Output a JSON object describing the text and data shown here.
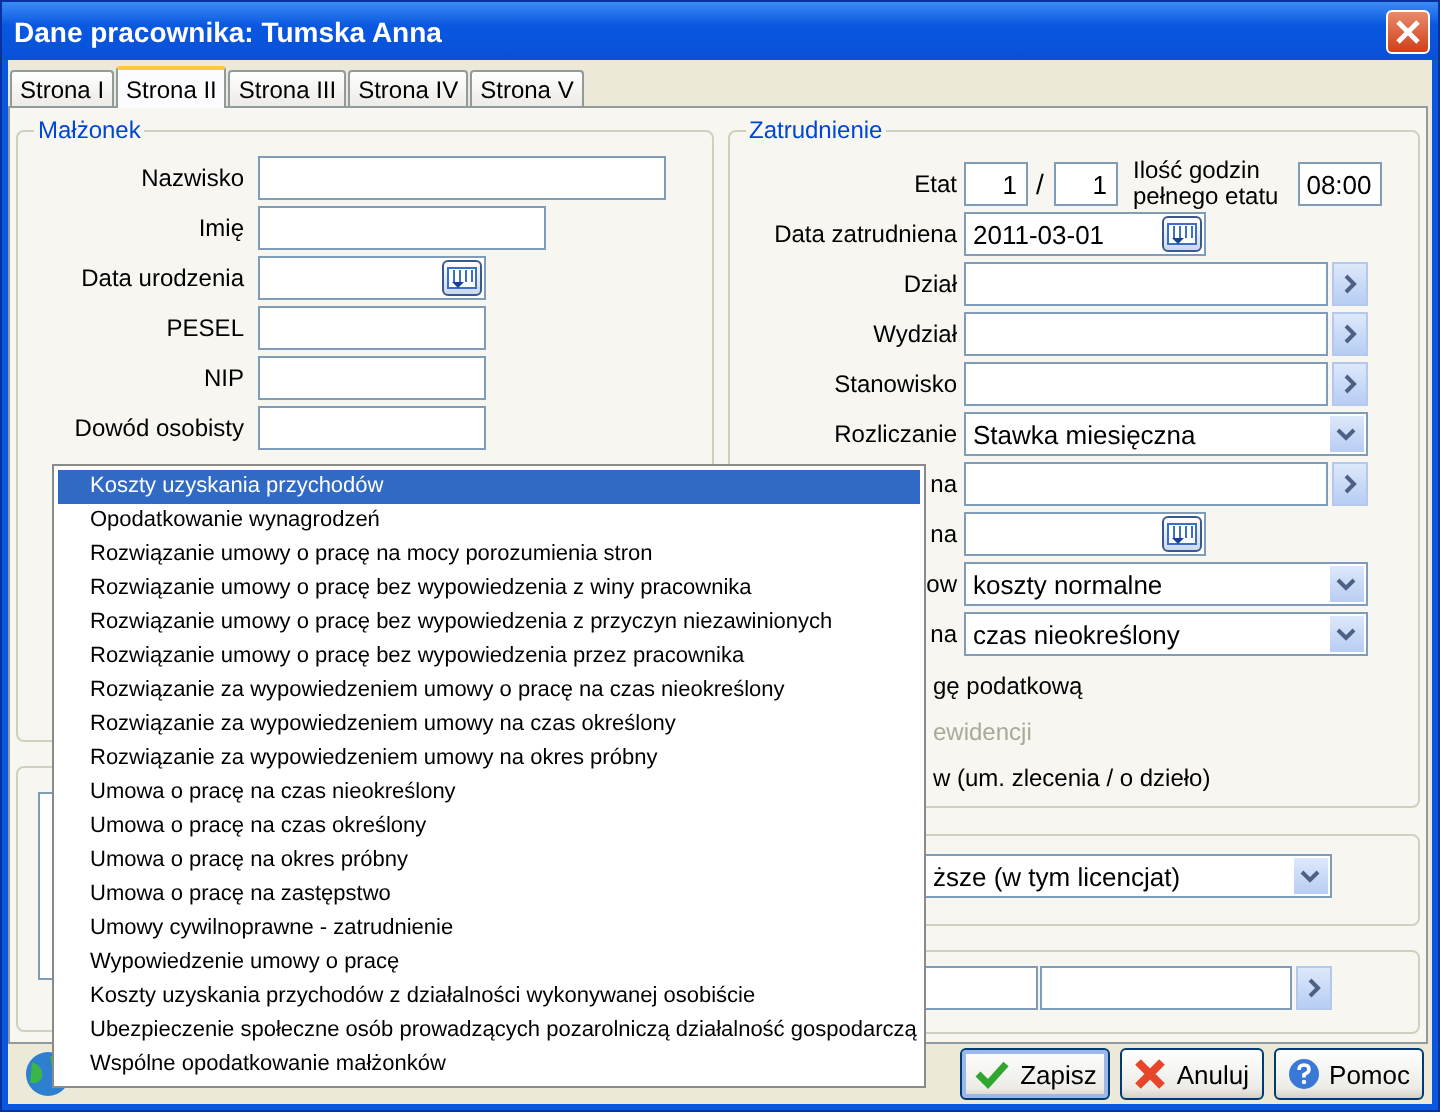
{
  "window": {
    "title": "Dane pracownika: Tumska Anna"
  },
  "tabs": [
    {
      "label": "Strona I",
      "selected": false
    },
    {
      "label": "Strona II",
      "selected": true
    },
    {
      "label": "Strona III",
      "selected": false
    },
    {
      "label": "Strona IV",
      "selected": false
    },
    {
      "label": "Strona V",
      "selected": false
    }
  ],
  "spouse": {
    "legend": "Małżonek",
    "fields": [
      {
        "kind": "text",
        "label": "Nazwisko"
      },
      {
        "kind": "text",
        "label": "Imię"
      },
      {
        "kind": "date",
        "label": "Data urodzenia"
      },
      {
        "kind": "text",
        "label": "PESEL"
      },
      {
        "kind": "text",
        "label": "NIP"
      },
      {
        "kind": "text",
        "label": "Dowód osobisty"
      }
    ]
  },
  "employment": {
    "legend": "Zatrudnienie",
    "etat": {
      "label": "Etat",
      "numerator": "1",
      "separator": "/",
      "denominator": "1",
      "hours_label": "Ilość godzin pełnego etatu",
      "hours": "08:00"
    },
    "rows": [
      {
        "kind": "date",
        "label": "Data zatrudniena",
        "value": "2011-03-01"
      },
      {
        "kind": "picker",
        "label": "Dział"
      },
      {
        "kind": "picker",
        "label": "Wydział"
      },
      {
        "kind": "picker",
        "label": "Stanowisko"
      },
      {
        "kind": "select",
        "label": "Rozliczanie",
        "value": "Stawka miesięczna"
      },
      {
        "kind": "picker",
        "label": "na"
      },
      {
        "kind": "date",
        "label": "na"
      },
      {
        "kind": "select",
        "label": "ow",
        "value": "koszty normalne"
      },
      {
        "kind": "select",
        "label": "na",
        "value": "czas nieokreślony"
      }
    ],
    "options": [
      {
        "label": "gę podatkową",
        "disabled": false
      },
      {
        "label": "ewidencji",
        "disabled": true
      },
      {
        "label": "w (um. zlecenia / o dzieło)",
        "disabled": false
      }
    ]
  },
  "education": {
    "value": "ższe (w tym licencjat)"
  },
  "menu": {
    "items": [
      {
        "label": "Koszty uzyskania przychodów",
        "selected": true
      },
      {
        "label": "Opodatkowanie wynagrodzeń",
        "selected": false
      },
      {
        "label": "Rozwiązanie umowy o pracę na mocy porozumienia stron",
        "selected": false
      },
      {
        "label": "Rozwiązanie umowy o pracę bez wypowiedzenia z winy pracownika",
        "selected": false
      },
      {
        "label": "Rozwiązanie umowy o pracę bez wypowiedzenia z przyczyn niezawinionych",
        "selected": false
      },
      {
        "label": "Rozwiązanie umowy o pracę bez wypowiedzenia przez pracownika",
        "selected": false
      },
      {
        "label": "Rozwiązanie za wypowiedzeniem umowy o pracę na czas nieokreślony",
        "selected": false
      },
      {
        "label": "Rozwiązanie za wypowiedzeniem umowy na czas określony",
        "selected": false
      },
      {
        "label": "Rozwiązanie za wypowiedzeniem umowy na okres próbny",
        "selected": false
      },
      {
        "label": "Umowa o pracę na czas nieokreślony",
        "selected": false
      },
      {
        "label": "Umowa o pracę na czas określony",
        "selected": false
      },
      {
        "label": "Umowa o pracę na okres próbny",
        "selected": false
      },
      {
        "label": "Umowa o pracę na zastępstwo",
        "selected": false
      },
      {
        "label": "Umowy cywilnoprawne - zatrudnienie",
        "selected": false
      },
      {
        "label": "Wypowiedzenie umowy o pracę",
        "selected": false
      },
      {
        "label": "Koszty uzyskania przychodów z działalności wykonywanej osobiście",
        "selected": false
      },
      {
        "label": "Ubezpieczenie społeczne osób prowadzących pozarolniczą działalność gospodarczą",
        "selected": false
      },
      {
        "label": "Wspólne opodatkowanie małżonków",
        "selected": false
      }
    ]
  },
  "buttons": [
    {
      "kind": "save",
      "label": "Zapisz"
    },
    {
      "kind": "cancel",
      "label": "Anuluj"
    },
    {
      "kind": "help",
      "label": "Pomoc"
    }
  ]
}
